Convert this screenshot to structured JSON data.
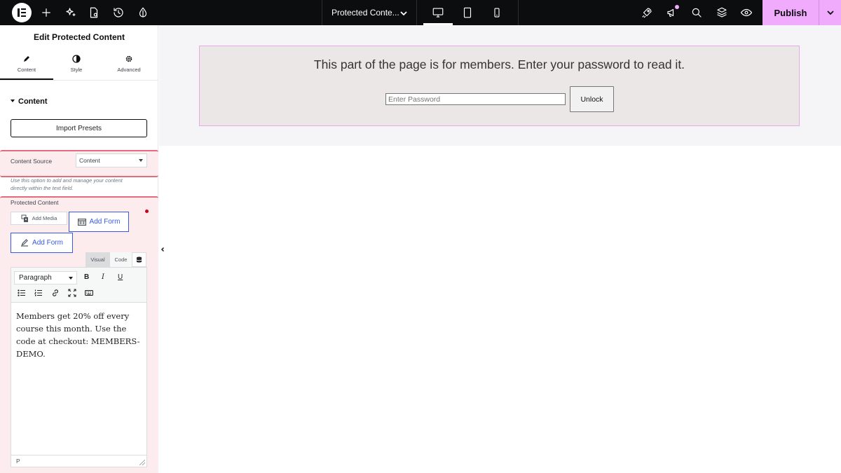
{
  "topbar": {
    "document_title": "Protected Conte...",
    "publish_label": "Publish"
  },
  "panel": {
    "title": "Edit Protected Content",
    "tabs": [
      {
        "label": "Content",
        "icon": "pencil-icon",
        "active": true
      },
      {
        "label": "Style",
        "icon": "half-circle-icon",
        "active": false
      },
      {
        "label": "Advanced",
        "icon": "gear-icon",
        "active": false
      }
    ],
    "section_title": "Content",
    "import_presets_label": "Import Presets",
    "content_source": {
      "label": "Content Source",
      "selected": "Content",
      "help": "Use this option to add and manage your content directly within the text field."
    },
    "protected_content": {
      "label": "Protected Content",
      "add_media_label": "Add Media",
      "add_form_label_1": "Add Form",
      "add_form_label_2": "Add Form"
    },
    "editor": {
      "tab_visual": "Visual",
      "tab_code": "Code",
      "format_select": "Paragraph",
      "bold": "B",
      "italic": "I",
      "underline": "U",
      "body_text": "Members get 20% off every course this month. Use the code at checkout: MEMBERS-DEMO.",
      "status_path": "P"
    }
  },
  "canvas": {
    "notice": "This part of the page is for members. Enter your password to read it.",
    "password_placeholder": "Enter Password",
    "unlock_label": "Unlock"
  },
  "colors": {
    "topbar_bg": "#0c0d0e",
    "publish_bg": "#f0abfc",
    "highlight_border": "#e26b7e",
    "highlight_bg": "#fdecee",
    "link_blue": "#3858e9",
    "protected_box_bg": "#ebe7e7",
    "protected_box_border": "#e7aae8"
  }
}
